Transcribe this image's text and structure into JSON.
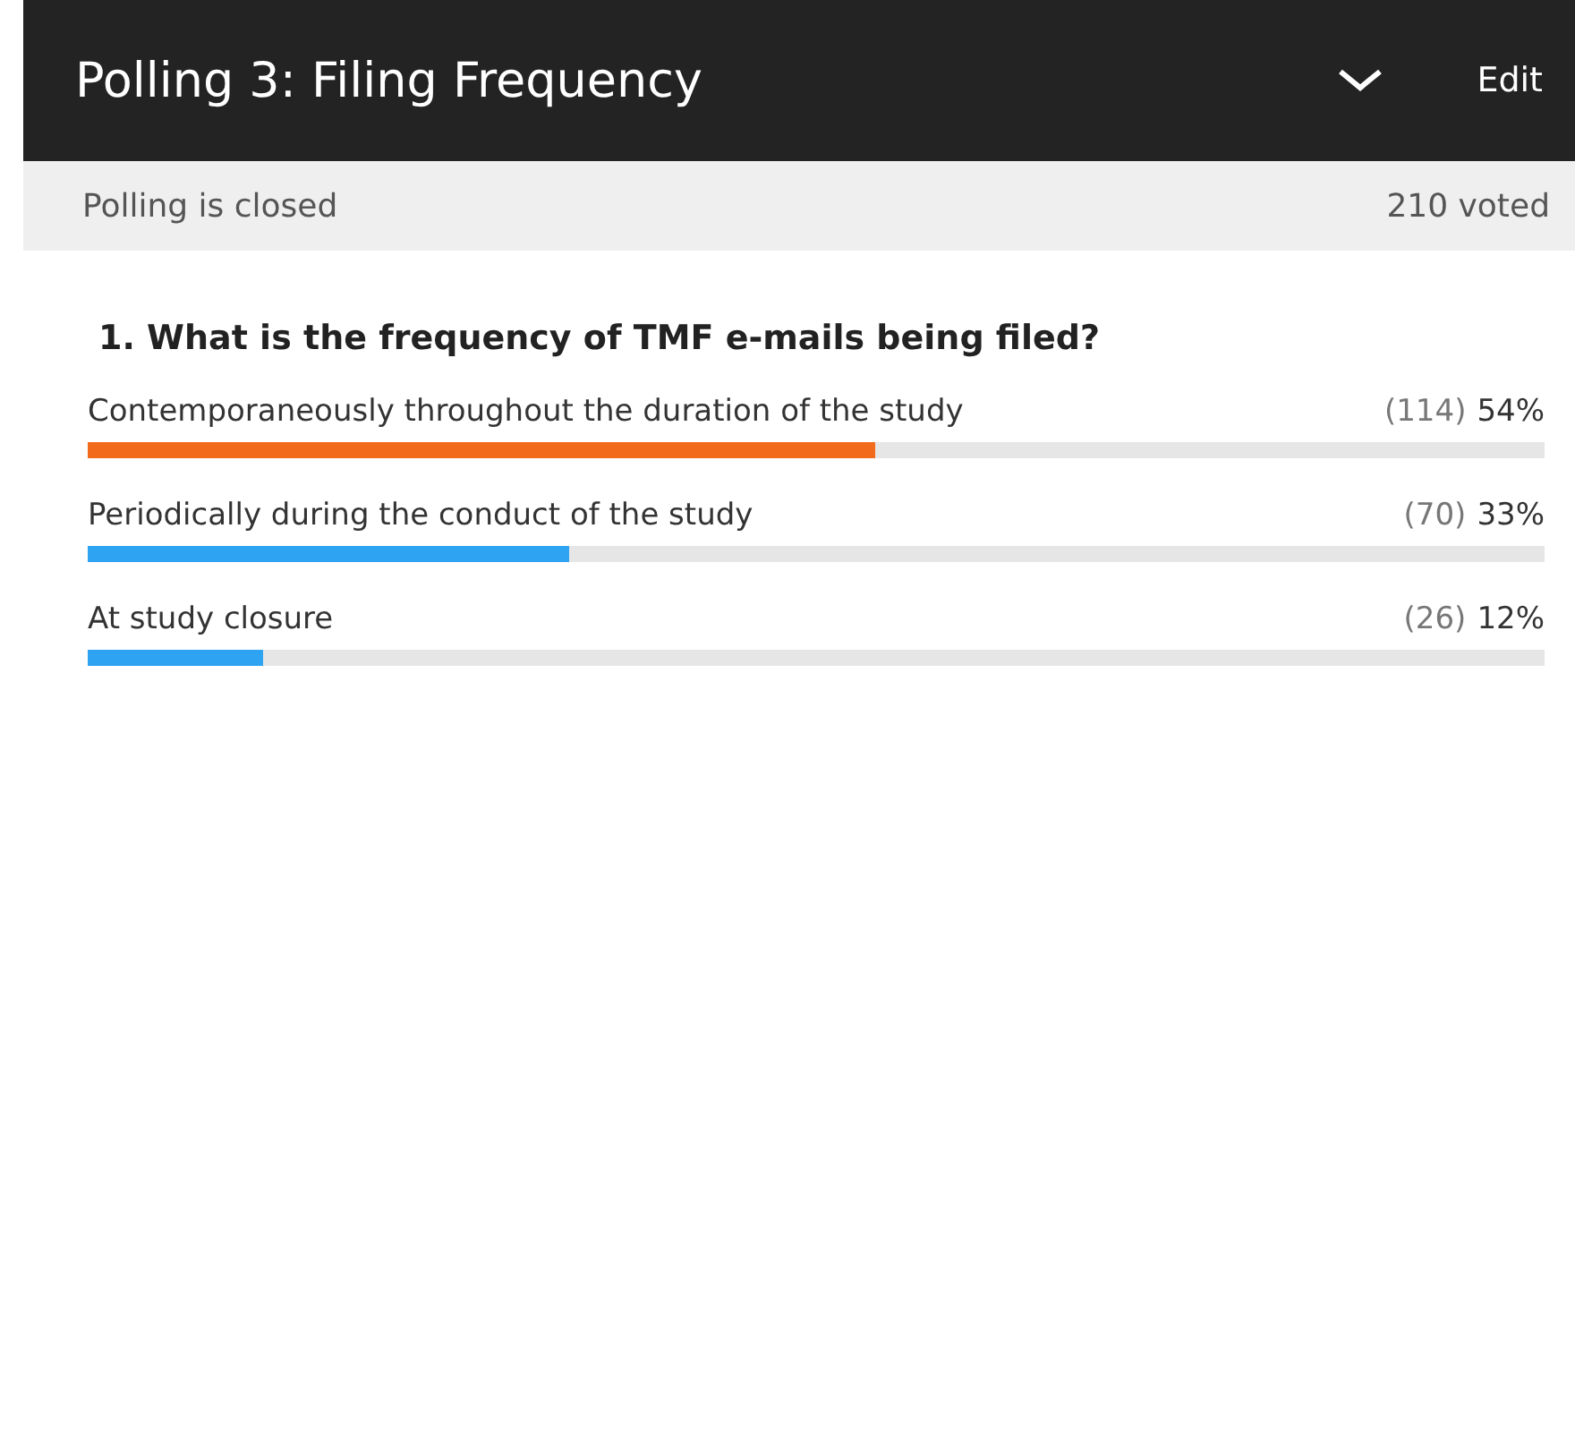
{
  "header": {
    "title": "Polling 3: Filing Frequency",
    "edit": "Edit"
  },
  "status_bar": {
    "state": "Polling is closed",
    "votes": "210 voted"
  },
  "questions": [
    {
      "text": "1. What is the frequency of TMF e-mails being filed?",
      "options": [
        {
          "label": "Contemporaneously throughout the duration of the study",
          "count": "(114)",
          "percent": "54%",
          "level": 0.54,
          "color": "#f26b1d"
        },
        {
          "label": "Periodically during the conduct of the study",
          "count": "(70)",
          "percent": "33%",
          "level": 0.33,
          "color": "#2ea3f2"
        },
        {
          "label": "At study closure",
          "count": "(26)",
          "percent": "12%",
          "level": 0.12,
          "color": "#2ea3f2"
        }
      ]
    }
  ]
}
